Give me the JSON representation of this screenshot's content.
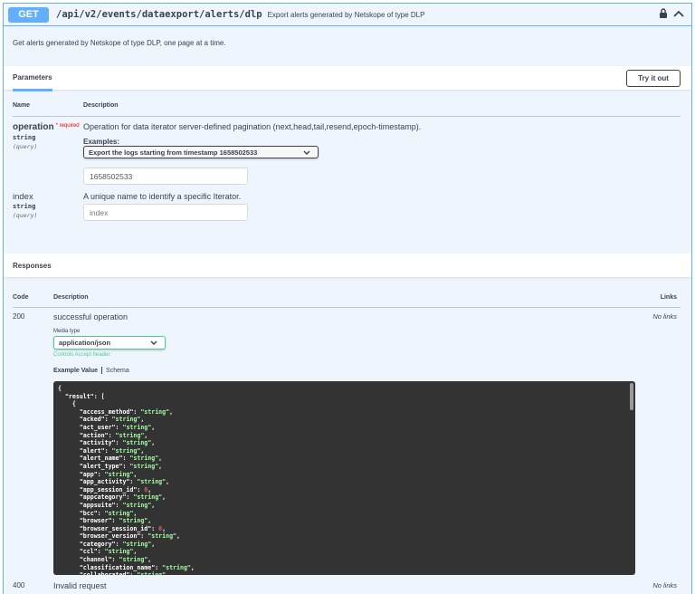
{
  "summary": {
    "method": "GET",
    "path": "/api/v2/events/dataexport/alerts/dlp",
    "description": "Export alerts generated by Netskope of type DLP"
  },
  "operation_description": "Get alerts generated by Netskope of type DLP, one page at a time.",
  "parameters_section": {
    "tab_label": "Parameters",
    "try_button": "Try it out",
    "col_name": "Name",
    "col_description": "Description",
    "params": [
      {
        "name": "operation",
        "required_label": "* required",
        "type": "string",
        "in": "(query)",
        "description": "Operation for data iterator server-defined pagination (next,head,tail,resend,epoch-timestamp).",
        "examples_label": "Examples:",
        "examples_selected": "Export the logs starting from timestamp 1658502533",
        "value": "1658502533"
      },
      {
        "name": "index",
        "type": "string",
        "in": "(query)",
        "description": "A unique name to identify a specific Iterator.",
        "placeholder": "index"
      }
    ]
  },
  "responses_section": {
    "title": "Responses",
    "col_code": "Code",
    "col_description": "Description",
    "col_links": "Links",
    "responses": [
      {
        "code": "200",
        "description": "successful operation",
        "links": "No links",
        "media_type_label": "Media type",
        "media_type": "application/json",
        "controls_note": "Controls Accept header.",
        "example_tab": "Example Value",
        "schema_tab": "Schema"
      },
      {
        "code": "400",
        "description": "Invalid request",
        "links": "No links"
      }
    ],
    "example_lines": [
      {
        "t": "brace",
        "text": "{"
      },
      {
        "t": "open",
        "indent": 1,
        "key": "\"result\"",
        "rest": ": ["
      },
      {
        "t": "brace",
        "indent": 2,
        "text": "{"
      },
      {
        "t": "kv",
        "indent": 3,
        "key": "\"access_method\"",
        "val": "\"string\"",
        "vt": "s"
      },
      {
        "t": "kv",
        "indent": 3,
        "key": "\"acked\"",
        "val": "\"string\"",
        "vt": "s"
      },
      {
        "t": "kv",
        "indent": 3,
        "key": "\"act_user\"",
        "val": "\"string\"",
        "vt": "s"
      },
      {
        "t": "kv",
        "indent": 3,
        "key": "\"action\"",
        "val": "\"string\"",
        "vt": "s"
      },
      {
        "t": "kv",
        "indent": 3,
        "key": "\"activity\"",
        "val": "\"string\"",
        "vt": "s"
      },
      {
        "t": "kv",
        "indent": 3,
        "key": "\"alert\"",
        "val": "\"string\"",
        "vt": "s"
      },
      {
        "t": "kv",
        "indent": 3,
        "key": "\"alert_name\"",
        "val": "\"string\"",
        "vt": "s"
      },
      {
        "t": "kv",
        "indent": 3,
        "key": "\"alert_type\"",
        "val": "\"string\"",
        "vt": "s"
      },
      {
        "t": "kv",
        "indent": 3,
        "key": "\"app\"",
        "val": "\"string\"",
        "vt": "s"
      },
      {
        "t": "kv",
        "indent": 3,
        "key": "\"app_activity\"",
        "val": "\"string\"",
        "vt": "s"
      },
      {
        "t": "kv",
        "indent": 3,
        "key": "\"app_session_id\"",
        "val": "0",
        "vt": "n"
      },
      {
        "t": "kv",
        "indent": 3,
        "key": "\"appcategory\"",
        "val": "\"string\"",
        "vt": "s"
      },
      {
        "t": "kv",
        "indent": 3,
        "key": "\"appsuite\"",
        "val": "\"string\"",
        "vt": "s"
      },
      {
        "t": "kv",
        "indent": 3,
        "key": "\"bcc\"",
        "val": "\"string\"",
        "vt": "s"
      },
      {
        "t": "kv",
        "indent": 3,
        "key": "\"browser\"",
        "val": "\"string\"",
        "vt": "s"
      },
      {
        "t": "kv",
        "indent": 3,
        "key": "\"browser_session_id\"",
        "val": "0",
        "vt": "n"
      },
      {
        "t": "kv",
        "indent": 3,
        "key": "\"browser_version\"",
        "val": "\"string\"",
        "vt": "s"
      },
      {
        "t": "kv",
        "indent": 3,
        "key": "\"category\"",
        "val": "\"string\"",
        "vt": "s"
      },
      {
        "t": "kv",
        "indent": 3,
        "key": "\"ccl\"",
        "val": "\"string\"",
        "vt": "s"
      },
      {
        "t": "kv",
        "indent": 3,
        "key": "\"channel\"",
        "val": "\"string\"",
        "vt": "s"
      },
      {
        "t": "kv",
        "indent": 3,
        "key": "\"classification_name\"",
        "val": "\"string\"",
        "vt": "s"
      },
      {
        "t": "kv",
        "indent": 3,
        "key": "\"collaborated\"",
        "val": "\"string\"",
        "vt": "s"
      }
    ]
  },
  "colors": {
    "get_blue": "#61affe",
    "panel_bg": "#eef5fd",
    "success_green": "#49cc90",
    "code_bg": "#333333",
    "string_green": "#a2fca2",
    "number_red": "#d36363",
    "required_red": "#ff0000"
  },
  "icons": {
    "lock": "lock-icon",
    "collapse": "chevron-up-icon",
    "dropdown": "chevron-down-icon"
  }
}
